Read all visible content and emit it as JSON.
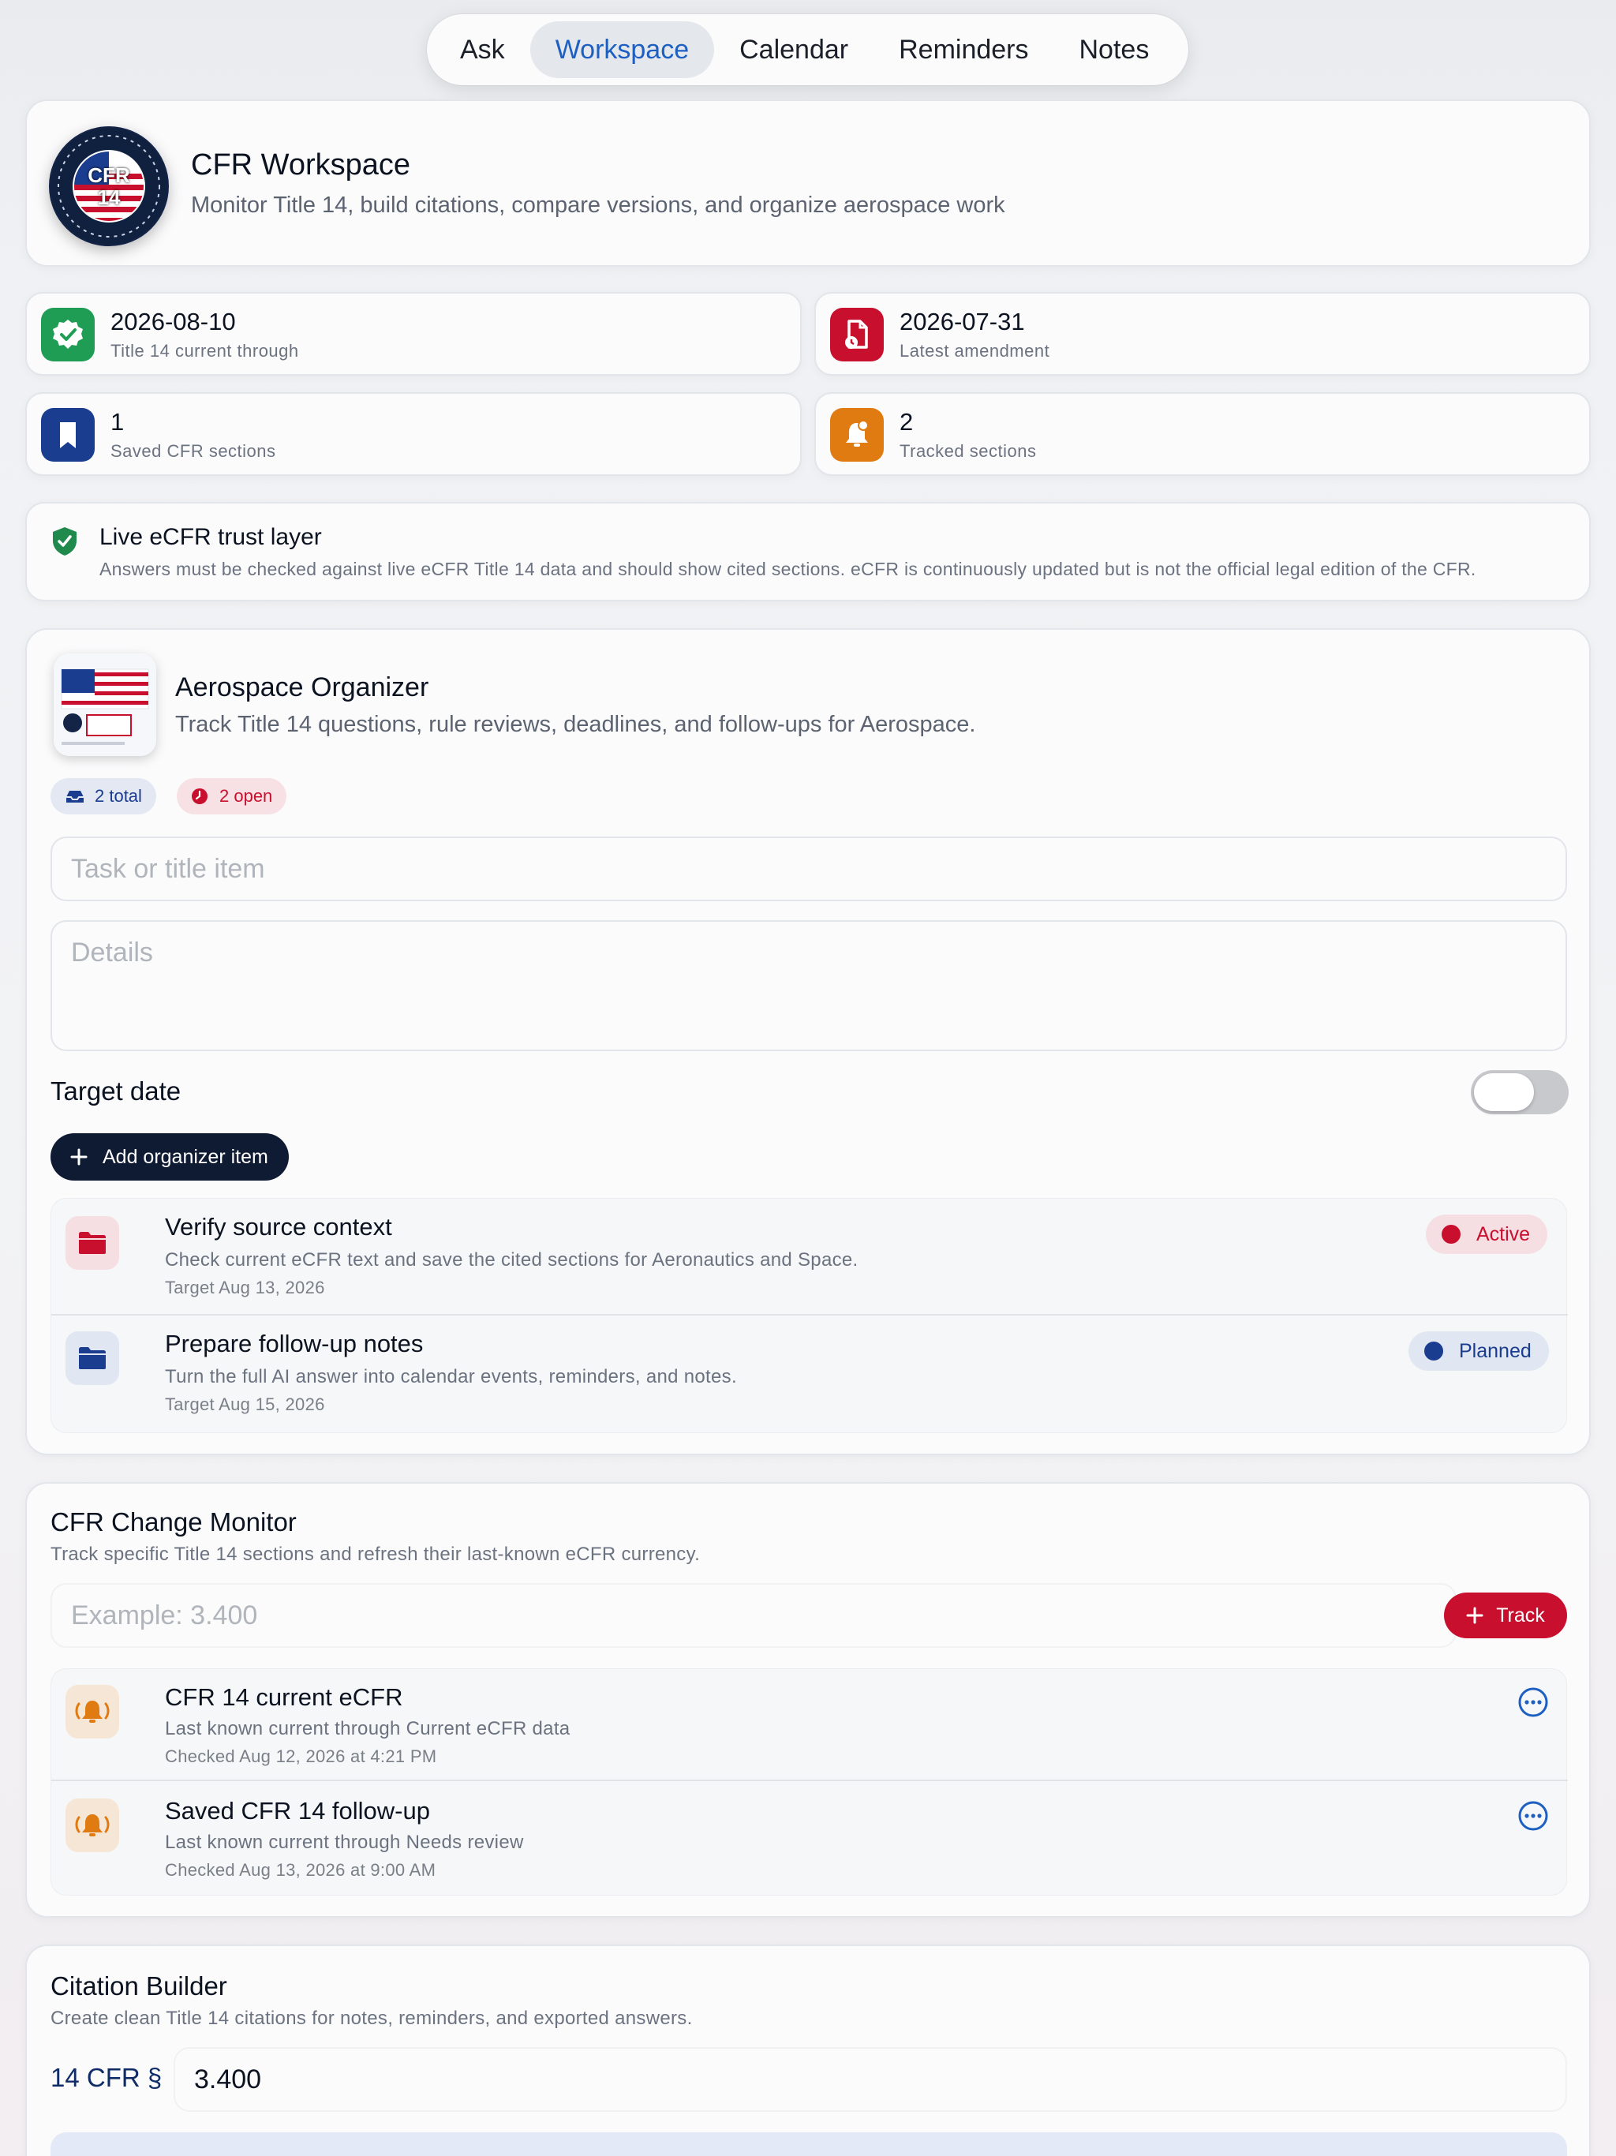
{
  "nav": {
    "tabs": [
      "Ask",
      "Workspace",
      "Calendar",
      "Reminders",
      "Notes"
    ],
    "active": "Workspace"
  },
  "header": {
    "logo_text": "CFR 14",
    "title": "CFR Workspace",
    "subtitle": "Monitor Title 14, build citations, compare versions, and organize aerospace work"
  },
  "stats": [
    {
      "value": "2026-08-10",
      "label": "Title 14 current through",
      "icon": "verified-badge-icon",
      "color": "#1f9d55"
    },
    {
      "value": "2026-07-31",
      "label": "Latest amendment",
      "icon": "document-clock-icon",
      "color": "#c8102e"
    },
    {
      "value": "1",
      "label": "Saved CFR sections",
      "icon": "bookmark-icon",
      "color": "#1a3d8f"
    },
    {
      "value": "2",
      "label": "Tracked sections",
      "icon": "bell-badge-icon",
      "color": "#e07b12"
    }
  ],
  "trust": {
    "title": "Live eCFR trust layer",
    "text": "Answers must be checked against live eCFR Title 14 data and should show cited sections. eCFR is continuously updated but is not the official legal edition of the CFR."
  },
  "organizer": {
    "title": "Aerospace Organizer",
    "subtitle": "Track Title 14 questions, rule reviews, deadlines, and follow-ups for Aerospace.",
    "total_badge": "2 total",
    "open_badge": "2 open",
    "task_placeholder": "Task or title item",
    "details_placeholder": "Details",
    "target_date_label": "Target date",
    "target_date_enabled": false,
    "add_button": "Add organizer item",
    "items": [
      {
        "title": "Verify source context",
        "detail": "Check current eCFR text and save the cited sections for Aeronautics and Space.",
        "target": "Target Aug 13, 2026",
        "status": "Active",
        "color": "#c8102e"
      },
      {
        "title": "Prepare follow-up notes",
        "detail": "Turn the full AI answer into calendar events, reminders, and notes.",
        "target": "Target Aug 15, 2026",
        "status": "Planned",
        "color": "#1a3d8f"
      }
    ]
  },
  "monitor": {
    "title": "CFR Change Monitor",
    "subtitle": "Track specific Title 14 sections and refresh their last-known eCFR currency.",
    "placeholder": "Example: 3.400",
    "track_button": "Track",
    "items": [
      {
        "title": "CFR 14 current eCFR",
        "detail": "Last known current through Current eCFR data",
        "checked": "Checked Aug 12, 2026 at 4:21 PM"
      },
      {
        "title": "Saved CFR 14 follow-up",
        "detail": "Last known current through Needs review",
        "checked": "Checked Aug 13, 2026 at 9:00 AM"
      }
    ]
  },
  "citation": {
    "title": "Citation Builder",
    "subtitle": "Create clean Title 14 citations for notes, reminders, and exported answers.",
    "prefix": "14 CFR §",
    "value": "3.400"
  }
}
